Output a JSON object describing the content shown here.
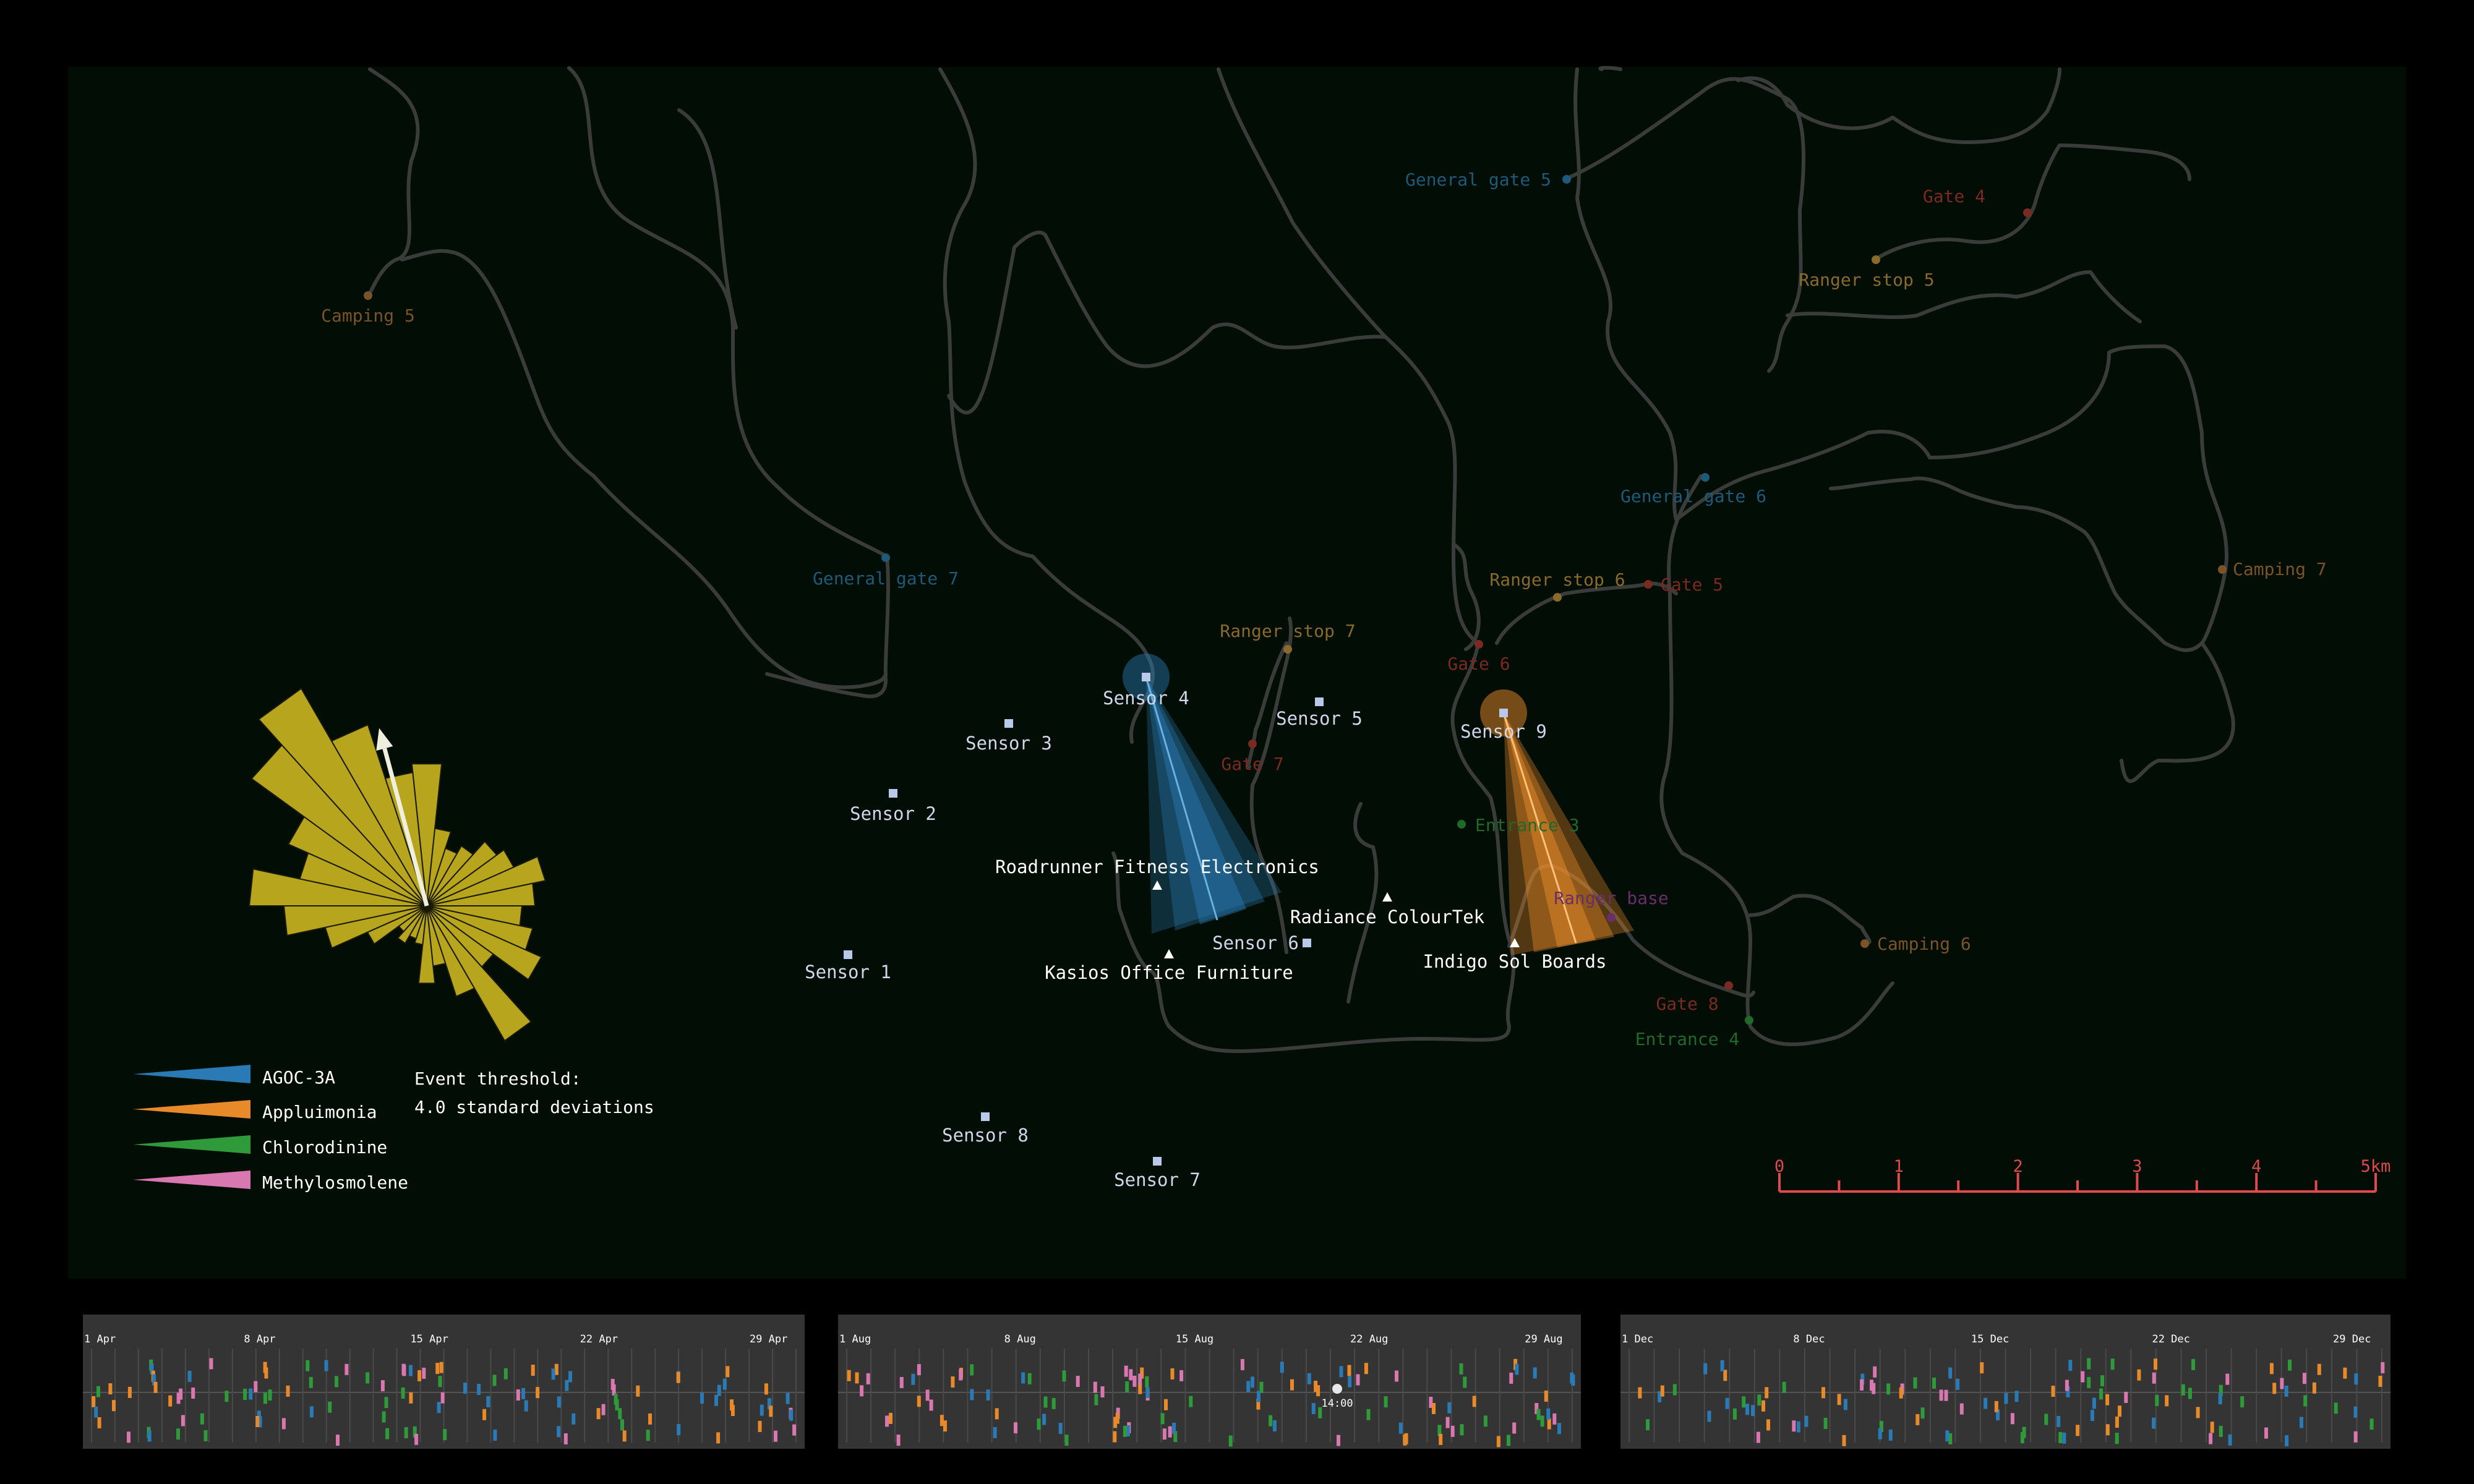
{
  "colors": {
    "background": "#000000",
    "map_panel": "#020d05",
    "road": "#3a3c3b",
    "gate_general": "#1d5a7a",
    "gate_ranger": "#8a6a2a",
    "gate_plain": "#7a2a20",
    "camping": "#7a5428",
    "entrance": "#1f6a2a",
    "ranger_base": "#6a2e6a",
    "sensor": "#b9c9e9",
    "factory": "#ffffff",
    "wind_rose": "#b7a51d",
    "scale": "#e04a4a",
    "timeline_bg": "#343434"
  },
  "map": {
    "landmarks": [
      {
        "name": "General gate 5",
        "kind": "general",
        "text": "General gate 5"
      },
      {
        "name": "Gate 4",
        "kind": "gate",
        "text": "Gate 4"
      },
      {
        "name": "Ranger stop 5",
        "kind": "ranger",
        "text": "Ranger stop 5"
      },
      {
        "name": "Camping 5",
        "kind": "camping",
        "text": "Camping 5"
      },
      {
        "name": "General gate 6",
        "kind": "general",
        "text": "General gate 6"
      },
      {
        "name": "Camping 7",
        "kind": "camping",
        "text": "Camping 7"
      },
      {
        "name": "Ranger stop 6",
        "kind": "ranger",
        "text": "Ranger stop 6"
      },
      {
        "name": "Gate 5",
        "kind": "gate",
        "text": "Gate 5"
      },
      {
        "name": "General gate 7",
        "kind": "general",
        "text": "General gate 7"
      },
      {
        "name": "Ranger stop 7",
        "kind": "ranger",
        "text": "Ranger stop 7"
      },
      {
        "name": "Gate 6",
        "kind": "gate",
        "text": "Gate 6"
      },
      {
        "name": "Gate 7",
        "kind": "gate",
        "text": "Gate 7"
      },
      {
        "name": "Entrance 3",
        "kind": "entrance",
        "text": "Entrance 3"
      },
      {
        "name": "Ranger base",
        "kind": "base",
        "text": "Ranger base"
      },
      {
        "name": "Camping 6",
        "kind": "camping",
        "text": "Camping 6"
      },
      {
        "name": "Gate 8",
        "kind": "gate",
        "text": "Gate 8"
      },
      {
        "name": "Entrance 4",
        "kind": "entrance",
        "text": "Entrance 4"
      }
    ],
    "sensors": [
      "Sensor 1",
      "Sensor 2",
      "Sensor 3",
      "Sensor 4",
      "Sensor 5",
      "Sensor 6",
      "Sensor 7",
      "Sensor 8",
      "Sensor 9"
    ],
    "factories": [
      "Roadrunner Fitness Electronics",
      "Kasios Office Furniture",
      "Radiance ColourTek",
      "Indigo Sol Boards"
    ]
  },
  "legend": {
    "chemicals": [
      {
        "name": "AGOC-3A",
        "color": "#2a7ab5"
      },
      {
        "name": "Appluimonia",
        "color": "#e8892a"
      },
      {
        "name": "Chlorodinine",
        "color": "#2f9a3a"
      },
      {
        "name": "Methylosmolene",
        "color": "#d977b0"
      }
    ],
    "threshold_line1": "Event threshold:",
    "threshold_line2": "4.0 standard deviations"
  },
  "wind_rose": {
    "petal_lengths": [
      0.33,
      0.18,
      0.14,
      0.16,
      0.2,
      0.22,
      0.28,
      0.25,
      0.22,
      0.25,
      0.29,
      0.19,
      0.36,
      0.22,
      0.14,
      0.18,
      0.09,
      0.08,
      0.1,
      0.08,
      0.15,
      0.24,
      0.33,
      0.41,
      0.3,
      0.35,
      0.5,
      0.58,
      0.44,
      0.31
    ],
    "wind_direction_deg": 345,
    "wind_strength": 0.85
  },
  "scale_bar": {
    "labels": [
      "0",
      "1",
      "2",
      "3",
      "4",
      "5km"
    ]
  },
  "timelines": [
    {
      "name": "april",
      "labels": [
        "1 Apr",
        "8 Apr",
        "15 Apr",
        "22 Apr",
        "29 Apr"
      ]
    },
    {
      "name": "august",
      "labels": [
        "1 Aug",
        "8 Aug",
        "15 Aug",
        "22 Aug",
        "29 Aug"
      ],
      "marker_label": "14:00"
    },
    {
      "name": "december",
      "labels": [
        "1 Dec",
        "8 Dec",
        "15 Dec",
        "22 Dec",
        "29 Dec"
      ]
    }
  ]
}
